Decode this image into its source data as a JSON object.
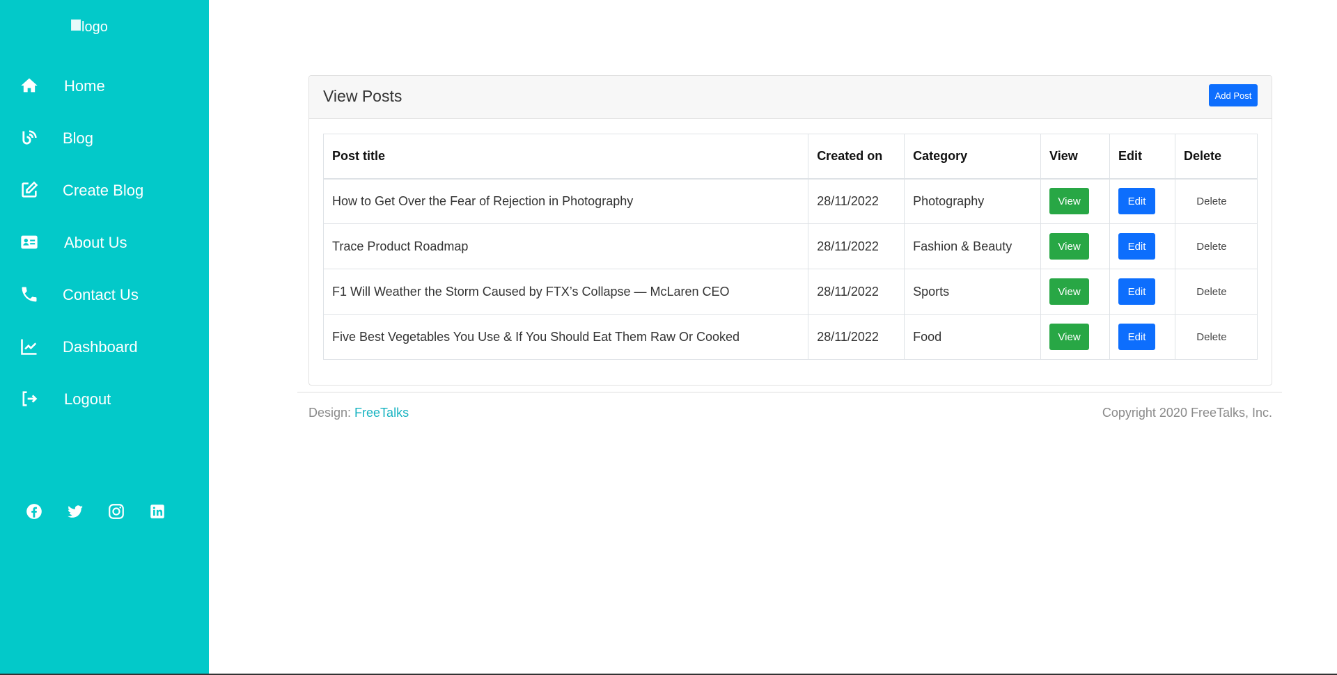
{
  "sidebar": {
    "logo_alt": "logo",
    "items": [
      {
        "label": "Home",
        "icon": "home-icon"
      },
      {
        "label": "Blog",
        "icon": "blog-icon"
      },
      {
        "label": "Create Blog",
        "icon": "edit-icon"
      },
      {
        "label": "About Us",
        "icon": "id-card-icon"
      },
      {
        "label": "Contact Us",
        "icon": "phone-icon"
      },
      {
        "label": "Dashboard",
        "icon": "chart-line-icon"
      },
      {
        "label": "Logout",
        "icon": "logout-icon"
      }
    ],
    "socials": [
      "facebook-icon",
      "twitter-icon",
      "instagram-icon",
      "linkedin-icon"
    ],
    "color": "#03c9c9"
  },
  "card": {
    "title": "View Posts",
    "add_label": "Add Post"
  },
  "table": {
    "headers": [
      "Post title",
      "Created on",
      "Category",
      "View",
      "Edit",
      "Delete"
    ],
    "rows": [
      {
        "title": "How to Get Over the Fear of Rejection in Photography",
        "created": "28/11/2022",
        "category": "Photography",
        "view": "View",
        "edit": "Edit",
        "delete": "Delete"
      },
      {
        "title": "Trace Product Roadmap",
        "created": "28/11/2022",
        "category": "Fashion & Beauty",
        "view": "View",
        "edit": "Edit",
        "delete": "Delete"
      },
      {
        "title": "F1 Will Weather the Storm Caused by FTX’s Collapse — McLaren CEO",
        "created": "28/11/2022",
        "category": "Sports",
        "view": "View",
        "edit": "Edit",
        "delete": "Delete"
      },
      {
        "title": "Five Best Vegetables You Use & If You Should Eat Them Raw Or Cooked",
        "created": "28/11/2022",
        "category": "Food",
        "view": "View",
        "edit": "Edit",
        "delete": "Delete"
      }
    ]
  },
  "footer": {
    "design_prefix": "Design: ",
    "design_link": "FreeTalks",
    "copyright": "Copyright 2020 FreeTalks, Inc."
  },
  "colors": {
    "view_button": "#28a745",
    "edit_button": "#0d6efd",
    "link": "#17b3c1"
  }
}
